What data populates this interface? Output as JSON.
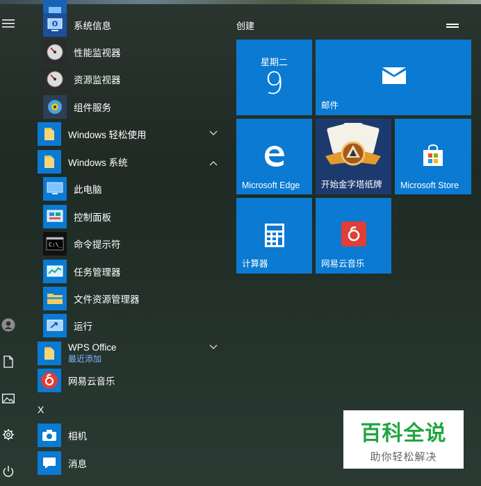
{
  "tiles_group": {
    "title": "创建",
    "calendar": {
      "day": "星期二",
      "date": "9"
    },
    "mail_label": "邮件",
    "edge_label": "Microsoft Edge",
    "solitaire_label": "开始金字塔纸牌",
    "store_label": "Microsoft Store",
    "calculator_label": "计算器",
    "music_label": "网易云音乐"
  },
  "app_list": {
    "items": [
      {
        "label": "系统信息"
      },
      {
        "label": "性能监视器"
      },
      {
        "label": "资源监视器"
      },
      {
        "label": "组件服务"
      },
      {
        "label": "Windows 轻松使用"
      },
      {
        "label": "Windows 系统"
      },
      {
        "label": "此电脑"
      },
      {
        "label": "控制面板"
      },
      {
        "label": "命令提示符"
      },
      {
        "label": "任务管理器"
      },
      {
        "label": "文件资源管理器"
      },
      {
        "label": "运行"
      },
      {
        "label": "WPS Office",
        "sublabel": "最近添加"
      },
      {
        "label": "网易云音乐"
      },
      {
        "label": "相机"
      },
      {
        "label": "消息"
      }
    ],
    "letter_x": "X"
  },
  "colors": {
    "tile_blue": "#0a7ad2",
    "watermark_green": "#21a540"
  },
  "watermark": {
    "title": "百科全说",
    "subtitle": "助你轻松解决"
  }
}
